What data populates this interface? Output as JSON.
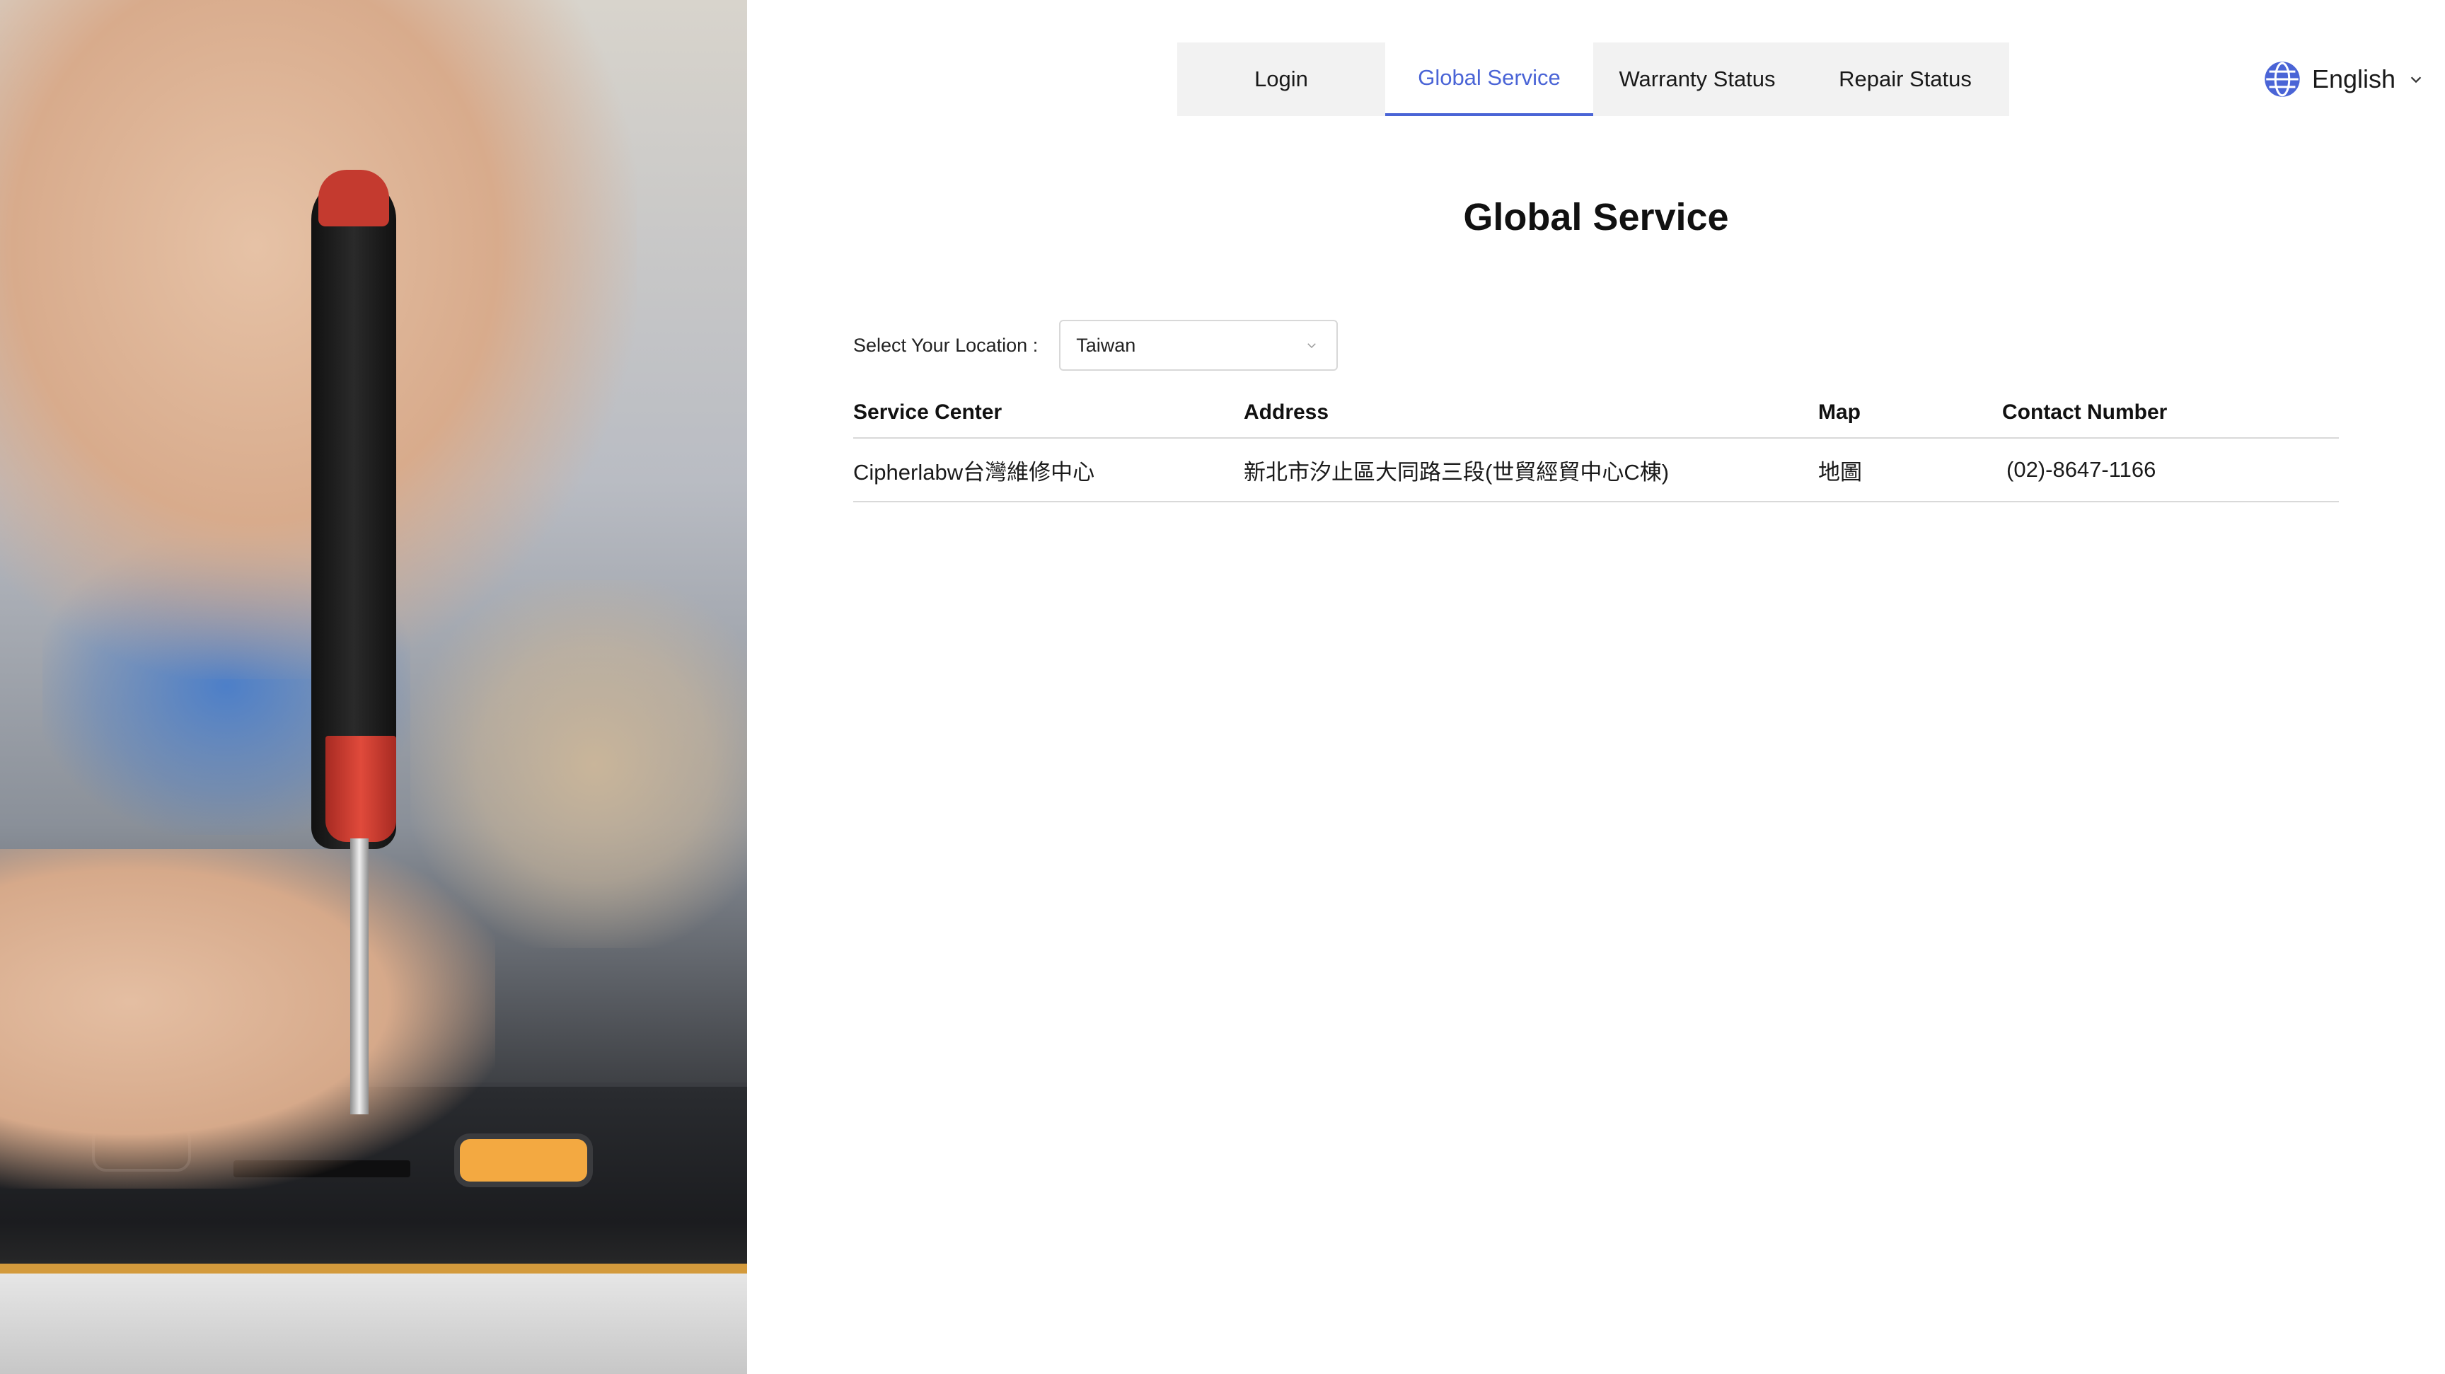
{
  "nav": {
    "tabs": [
      {
        "label": "Login"
      },
      {
        "label": "Global Service",
        "active": true
      },
      {
        "label": "Warranty Status"
      },
      {
        "label": "Repair Status"
      }
    ]
  },
  "language": {
    "label": "English",
    "icon": "globe-icon"
  },
  "page": {
    "title": "Global Service"
  },
  "location": {
    "label": "Select Your Location :",
    "selected": "Taiwan"
  },
  "table": {
    "headers": [
      "Service Center",
      "Address",
      "Map",
      "Contact Number"
    ],
    "rows": [
      {
        "service_center": "Cipherlabw台灣維修中心",
        "address": "新北市汐止區大同路三段(世貿經貿中心C棟)",
        "map": "地圖",
        "contact": "(02)-8647-1166"
      }
    ]
  },
  "colors": {
    "accent": "#4a64d6",
    "tab_bg": "#f2f2f2",
    "divider": "#d9d9d9"
  }
}
